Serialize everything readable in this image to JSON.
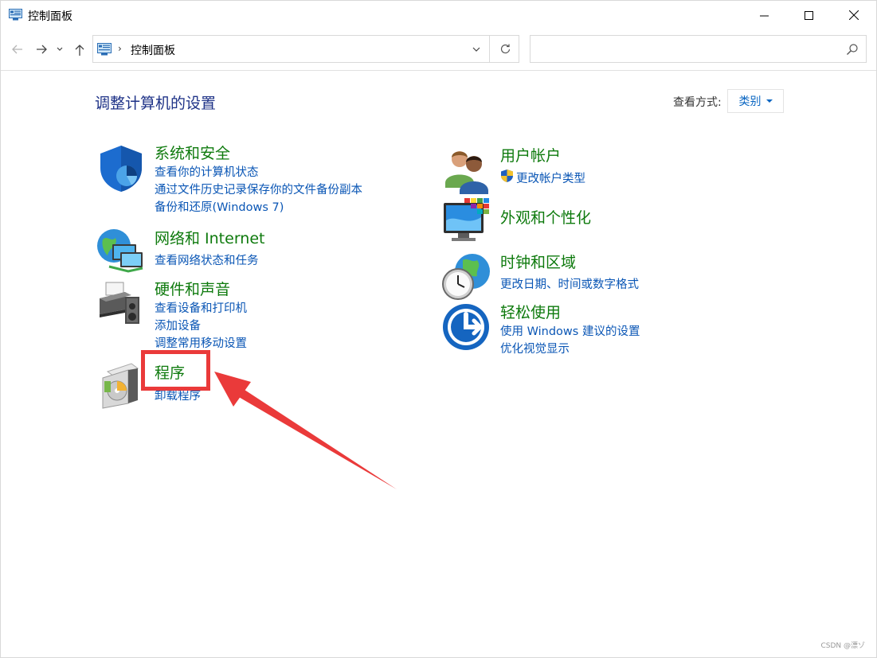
{
  "window": {
    "title": "控制面板"
  },
  "nav": {
    "breadcrumb": "控制面板",
    "search_placeholder": ""
  },
  "header": {
    "page_title": "调整计算机的设置",
    "view_by_label": "查看方式:",
    "view_by_value": "类别"
  },
  "categories_left": [
    {
      "title": "系统和安全",
      "icon": "shield-icon",
      "links": [
        "查看你的计算机状态",
        "通过文件历史记录保存你的文件备份副本",
        "备份和还原(Windows 7)"
      ]
    },
    {
      "title": "网络和 Internet",
      "icon": "network-globe-icon",
      "links": [
        "查看网络状态和任务"
      ]
    },
    {
      "title": "硬件和声音",
      "icon": "printer-icon",
      "links": [
        "查看设备和打印机",
        "添加设备",
        "调整常用移动设置"
      ]
    },
    {
      "title": "程序",
      "icon": "programs-disc-icon",
      "links": [
        "卸载程序"
      ]
    }
  ],
  "categories_right": [
    {
      "title": "用户帐户",
      "icon": "users-icon",
      "links": [
        "更改帐户类型"
      ]
    },
    {
      "title": "外观和个性化",
      "icon": "monitor-palette-icon",
      "links": []
    },
    {
      "title": "时钟和区域",
      "icon": "clock-globe-icon",
      "links": [
        "更改日期、时间或数字格式"
      ]
    },
    {
      "title": "轻松使用",
      "icon": "ease-of-access-icon",
      "links": [
        "使用 Windows 建议的设置",
        "优化视觉显示"
      ]
    }
  ],
  "watermark": "CSDN @漂ゾ",
  "colors": {
    "category_title": "#0e7a0d",
    "link": "#0a56b5",
    "page_title": "#1e3287",
    "annotation_red": "#ea3a3a"
  }
}
